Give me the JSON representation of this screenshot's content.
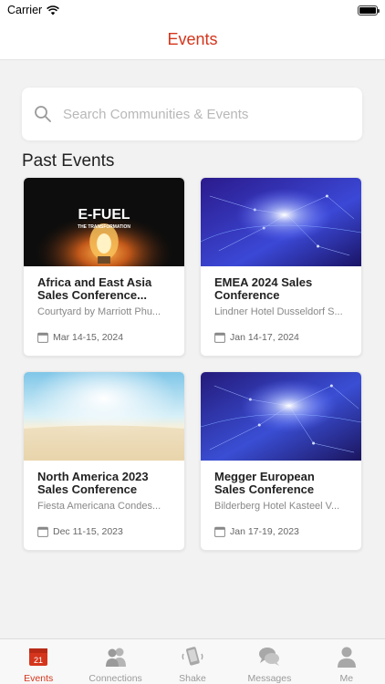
{
  "status_bar": {
    "carrier": "Carrier",
    "time": ""
  },
  "nav": {
    "title": "Events"
  },
  "search": {
    "placeholder": "Search Communities & Events"
  },
  "section": {
    "title": "Past Events"
  },
  "events": [
    {
      "title": "Africa and East Asia Sales Conference...",
      "location": "Courtyard by Marriott Phu...",
      "date": "Mar 14-15, 2024",
      "image": "e-fuel-banner",
      "image_title": "E-FUEL",
      "image_subtitle": "THE TRANSFORMATION"
    },
    {
      "title": "EMEA 2024 Sales Conference",
      "location": "Lindner Hotel Dusseldorf S...",
      "date": "Jan 14-17, 2024",
      "image": "network-globe"
    },
    {
      "title": "North America 2023 Sales Conference",
      "location": "Fiesta Americana Condes...",
      "date": "Dec 11-15, 2023",
      "image": "beach"
    },
    {
      "title": "Megger European Sales Conference",
      "location": "Bilderberg Hotel Kasteel V...",
      "date": "Jan 17-19, 2023",
      "image": "network-globe"
    }
  ],
  "tabs": [
    {
      "label": "Events",
      "icon": "calendar-icon",
      "badge": "21",
      "active": true
    },
    {
      "label": "Connections",
      "icon": "people-icon",
      "active": false
    },
    {
      "label": "Shake",
      "icon": "phone-shake-icon",
      "active": false
    },
    {
      "label": "Messages",
      "icon": "chat-icon",
      "active": false
    },
    {
      "label": "Me",
      "icon": "person-icon",
      "active": false
    }
  ],
  "colors": {
    "accent": "#d4351c",
    "background": "#f2f2f2",
    "inactive_tab": "#9a9a9a"
  }
}
